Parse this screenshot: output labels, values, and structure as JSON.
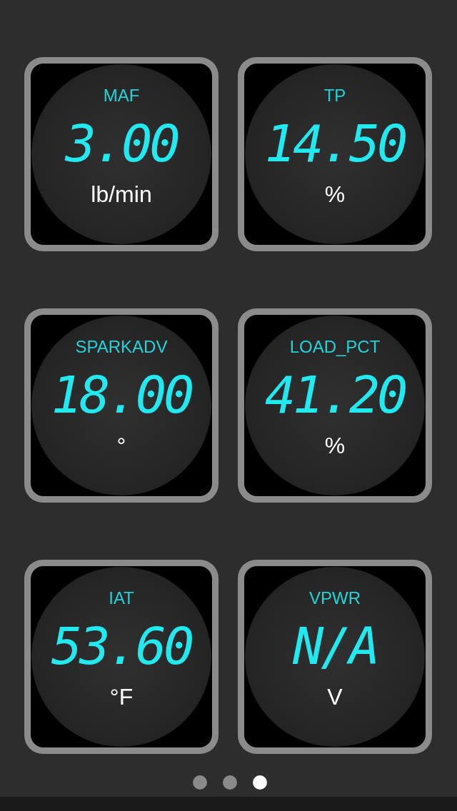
{
  "gauges": [
    {
      "label": "MAF",
      "value": "3.00",
      "unit": "lb/min"
    },
    {
      "label": "TP",
      "value": "14.50",
      "unit": "%"
    },
    {
      "label": "SPARKADV",
      "value": "18.00",
      "unit": "°"
    },
    {
      "label": "LOAD_PCT",
      "value": "41.20",
      "unit": "%"
    },
    {
      "label": "IAT",
      "value": "53.60",
      "unit": "°F"
    },
    {
      "label": "VPWR",
      "value": "N/A",
      "unit": "V"
    }
  ],
  "pages": [
    {
      "selected": false
    },
    {
      "selected": false
    },
    {
      "selected": true
    }
  ]
}
